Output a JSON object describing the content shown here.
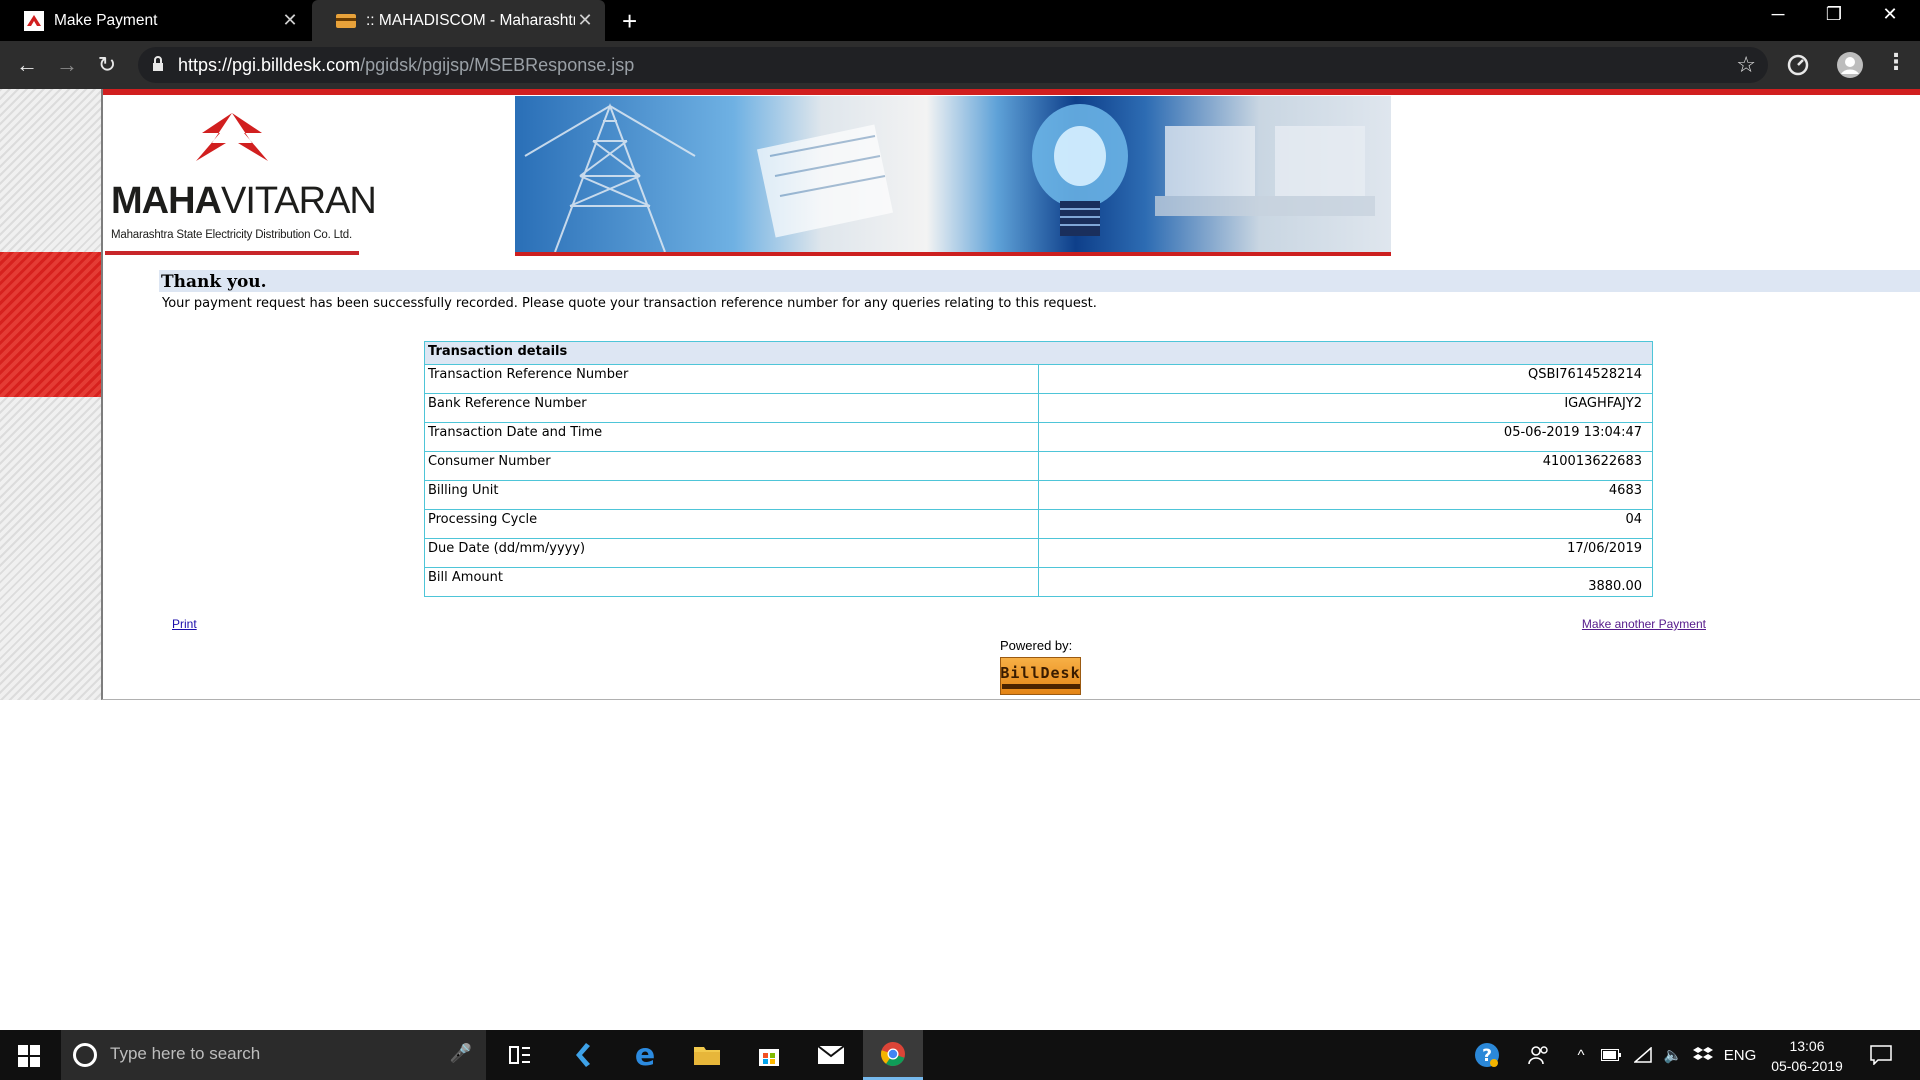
{
  "browser": {
    "tabs": [
      {
        "title": "Make Payment"
      },
      {
        "title": ":: MAHADISCOM - Maharashtra S"
      }
    ],
    "new_tab_label": "+",
    "url_host": "https://pgi.billdesk.com",
    "url_path": "/pgidsk/pgijsp/MSEBResponse.jsp",
    "window_controls": {
      "minimize": "─",
      "restore": "❐",
      "close": "✕"
    }
  },
  "header": {
    "logo_bold": "MAHA",
    "logo_regular": "VITARAN",
    "logo_subtitle": "Maharashtra State Electricity Distribution Co. Ltd."
  },
  "confirmation": {
    "title": "Thank you.",
    "message": "Your payment request has been successfully recorded. Please quote your transaction reference number for any queries relating to this request."
  },
  "transaction": {
    "heading": "Transaction details",
    "rows": [
      {
        "label": "Transaction Reference Number",
        "value": "QSBI7614528214"
      },
      {
        "label": "Bank Reference Number",
        "value": "IGAGHFAJY2"
      },
      {
        "label": "Transaction Date and Time",
        "value": "05-06-2019 13:04:47"
      },
      {
        "label": "Consumer Number",
        "value": "410013622683"
      },
      {
        "label": "Billing Unit",
        "value": "4683"
      },
      {
        "label": "Processing Cycle",
        "value": "04"
      },
      {
        "label": "Due Date (dd/mm/yyyy)",
        "value": "17/06/2019"
      },
      {
        "label": "Bill Amount",
        "value": "3880.00"
      }
    ]
  },
  "footer": {
    "print_label": "Print",
    "another_payment_label": "Make another Payment",
    "powered_by": "Powered by:",
    "billdesk_name": "BillDesk"
  },
  "taskbar": {
    "search_placeholder": "Type here to search",
    "language": "ENG",
    "time": "13:06",
    "date": "05-06-2019"
  },
  "colors": {
    "accent_red": "#d11f1f",
    "table_border": "#4ec5d8",
    "header_fill": "#dde6f3"
  }
}
